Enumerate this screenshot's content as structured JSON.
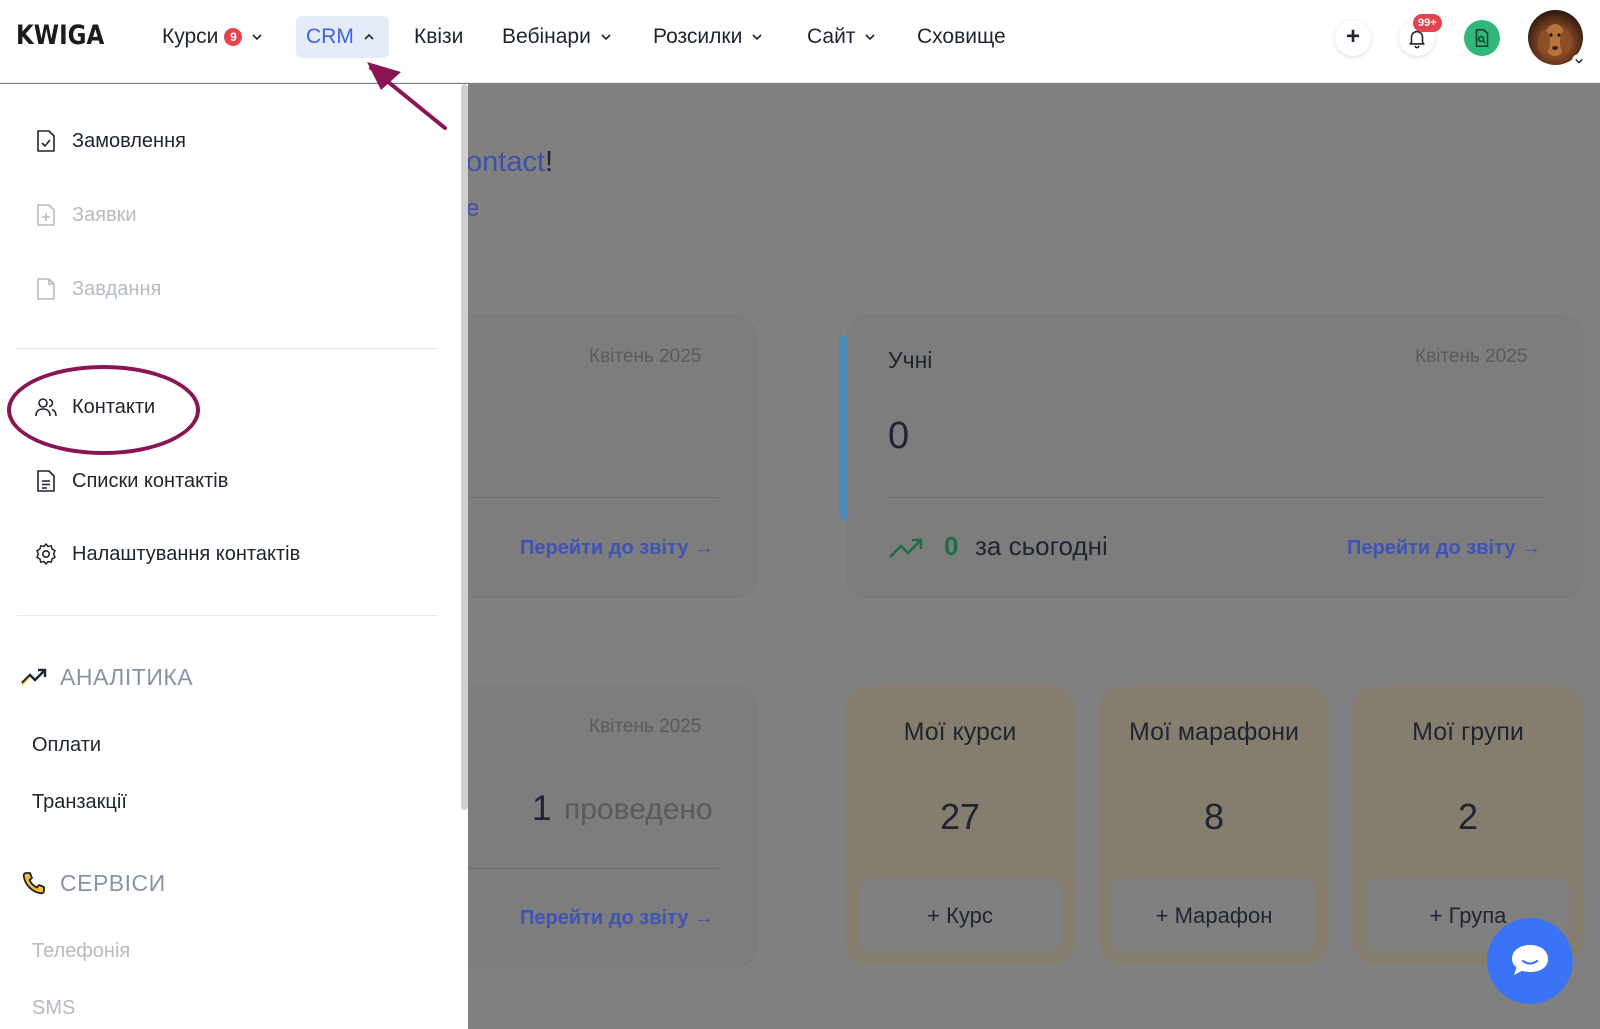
{
  "app": {
    "logo": "KWIGA"
  },
  "nav": {
    "courses": {
      "label": "Курси",
      "badge": "9"
    },
    "crm": {
      "label": "CRM"
    },
    "quizzes": {
      "label": "Квізи"
    },
    "webinars": {
      "label": "Вебінари"
    },
    "mailings": {
      "label": "Розсилки"
    },
    "site": {
      "label": "Сайт"
    },
    "storage": {
      "label": "Сховище"
    },
    "notifications_badge": "99+"
  },
  "crm_menu": {
    "orders": "Замовлення",
    "requests": "Заявки",
    "tasks": "Завдання",
    "contacts": "Контакти",
    "contact_lists": "Списки контактів",
    "contact_settings": "Налаштування контактів",
    "analytics": {
      "heading": "АНАЛІТИКА",
      "payments": "Оплати",
      "transactions": "Транзакції"
    },
    "services": {
      "heading": "СЕРВІСИ",
      "telephony": "Телефонія",
      "sms": "SMS"
    }
  },
  "background": {
    "greeting_link": "ontact",
    "greeting_excl": "!",
    "greeting_sub": "e",
    "card1": {
      "date": "Квітень 2025",
      "report_link": "Перейти до звіту →"
    },
    "students": {
      "title": "Учні",
      "date": "Квітень 2025",
      "count": "0",
      "today_count": "0",
      "today_label": "за сьогодні",
      "report_link": "Перейти до звіту →"
    },
    "card3": {
      "date": "Квітень 2025",
      "held_count": "1",
      "held_label": "проведено",
      "report_link": "Перейти до звіту →"
    },
    "my_courses": {
      "title": "Мої курси",
      "count": "27",
      "button": "+ Курс"
    },
    "my_marathons": {
      "title": "Мої марафони",
      "count": "8",
      "button": "+ Марафон"
    },
    "my_groups": {
      "title": "Мої групи",
      "count": "2",
      "button": "+ Група"
    }
  },
  "colors": {
    "accent": "#3d63dd",
    "annotation": "#8a1553",
    "badge": "#e5434d",
    "green": "#2fb87a",
    "chat": "#3a73f5"
  }
}
